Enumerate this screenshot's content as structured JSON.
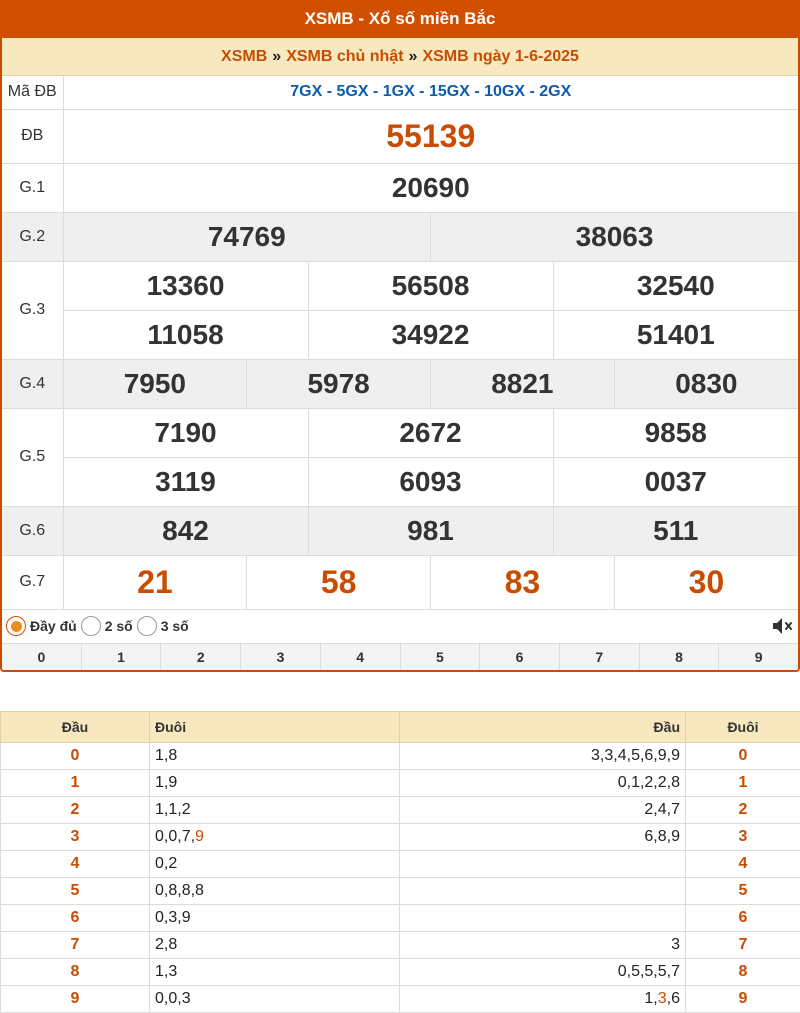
{
  "header": {
    "title": "XSMB - Xổ số miền Bắc"
  },
  "breadcrumb": {
    "item1": "XSMB",
    "item2": "XSMB chủ nhật",
    "item3": "XSMB ngày 1-6-2025",
    "sep": "»"
  },
  "madb": {
    "label": "Mã ĐB",
    "value": "7GX - 5GX - 1GX - 15GX - 10GX - 2GX"
  },
  "prizes": {
    "db": {
      "label": "ĐB",
      "numbers": [
        "55139"
      ]
    },
    "g1": {
      "label": "G.1",
      "numbers": [
        "20690"
      ]
    },
    "g2": {
      "label": "G.2",
      "numbers": [
        "74769",
        "38063"
      ]
    },
    "g3": {
      "label": "G.3",
      "numbers": [
        "13360",
        "56508",
        "32540",
        "11058",
        "34922",
        "51401"
      ]
    },
    "g4": {
      "label": "G.4",
      "numbers": [
        "7950",
        "5978",
        "8821",
        "0830"
      ]
    },
    "g5": {
      "label": "G.5",
      "numbers": [
        "7190",
        "2672",
        "9858",
        "3119",
        "6093",
        "0037"
      ]
    },
    "g6": {
      "label": "G.6",
      "numbers": [
        "842",
        "981",
        "511"
      ]
    },
    "g7": {
      "label": "G.7",
      "numbers": [
        "21",
        "58",
        "83",
        "30"
      ]
    }
  },
  "options": {
    "full": "Đầy đủ",
    "two": "2 số",
    "three": "3 số",
    "selected": "full"
  },
  "digits": [
    "0",
    "1",
    "2",
    "3",
    "4",
    "5",
    "6",
    "7",
    "8",
    "9"
  ],
  "loto": {
    "headers": {
      "dau": "Đầu",
      "duoi": "Đuôi",
      "dau2": "Đầu",
      "duoi2": "Đuôi"
    },
    "rows": [
      {
        "d": "0",
        "left": "1,8",
        "right": "3,3,4,5,6,9,9"
      },
      {
        "d": "1",
        "left": "1,9",
        "right": "0,1,2,2,8"
      },
      {
        "d": "2",
        "left": "1,1,2",
        "right": "2,4,7"
      },
      {
        "d": "3",
        "left_pre": "0,0,7,",
        "left_hl": "9",
        "left_post": "",
        "right": "6,8,9"
      },
      {
        "d": "4",
        "left": "0,2",
        "right": ""
      },
      {
        "d": "5",
        "left": "0,8,8,8",
        "right": ""
      },
      {
        "d": "6",
        "left": "0,3,9",
        "right": ""
      },
      {
        "d": "7",
        "left": "2,8",
        "right": "3"
      },
      {
        "d": "8",
        "left": "1,3",
        "right": "0,5,5,5,7"
      },
      {
        "d": "9",
        "left": "0,0,3",
        "right_pre": "1,",
        "right_hl": "3",
        "right_post": ",6"
      }
    ]
  },
  "colors": {
    "brand": "#d14f00",
    "accent_bg": "#f8e8bf",
    "link": "#0b5cad",
    "shade": "#efefef"
  },
  "icons": {
    "mute": "volume-mute-icon"
  }
}
